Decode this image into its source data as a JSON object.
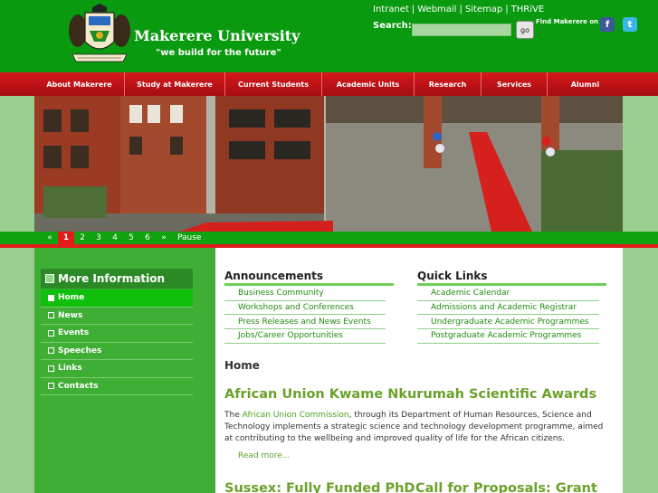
{
  "header": {
    "brand": "Makerere University",
    "motto": "\"we build for the future\"",
    "top_links": [
      "Intranet",
      "Webmail",
      "Sitemap",
      "THRiVE"
    ],
    "search_label": "Search:",
    "search_value": "",
    "go_label": "go",
    "find_on": "Find Makerere on :",
    "facebook_glyph": "f",
    "twitter_glyph": "t"
  },
  "nav": {
    "items": [
      "About Makerere",
      "Study at Makerere",
      "Current Students",
      "Academic Units",
      "Research",
      "Services",
      "Alumni"
    ]
  },
  "pager": {
    "prev": "«",
    "pages": [
      "1",
      "2",
      "3",
      "4",
      "5",
      "6"
    ],
    "active": "1",
    "next": "»",
    "pause": "Pause"
  },
  "sidebar": {
    "title": "More Information",
    "items": [
      "Home",
      "News",
      "Events",
      "Speeches",
      "Links",
      "Contacts"
    ]
  },
  "announcements": {
    "title": "Announcements",
    "items": [
      "Business Community",
      "Workshops and Conferences",
      "Press Releases and News Events",
      "Jobs/Career Opportunities"
    ]
  },
  "quick_links": {
    "title": "Quick Links",
    "items": [
      "Academic Calendar",
      "Admissions and Academic Registrar",
      "Undergraduate Academic Programmes",
      "Postgraduate Academic Programmes"
    ]
  },
  "main": {
    "section_label": "Home",
    "article": {
      "title": "African Union Kwame Nkurumah Scientific Awards",
      "body_prefix": "The ",
      "body_highlight": "African Union Commission",
      "body_suffix": ", through its Department of Human Resources, Science and Technology implements a strategic science and technology development programme, aimed at contributing to the wellbeing and improved quality of life for the African citizens.",
      "read_more": "Read more..."
    },
    "next_titles": [
      "Sussex: Fully Funded PhD",
      "Call for Proposals: Grant"
    ]
  },
  "colors": {
    "header_green": "#0a9a10",
    "nav_red": "#d8191d",
    "link_green": "#208a10",
    "title_green": "#6aa12a"
  }
}
